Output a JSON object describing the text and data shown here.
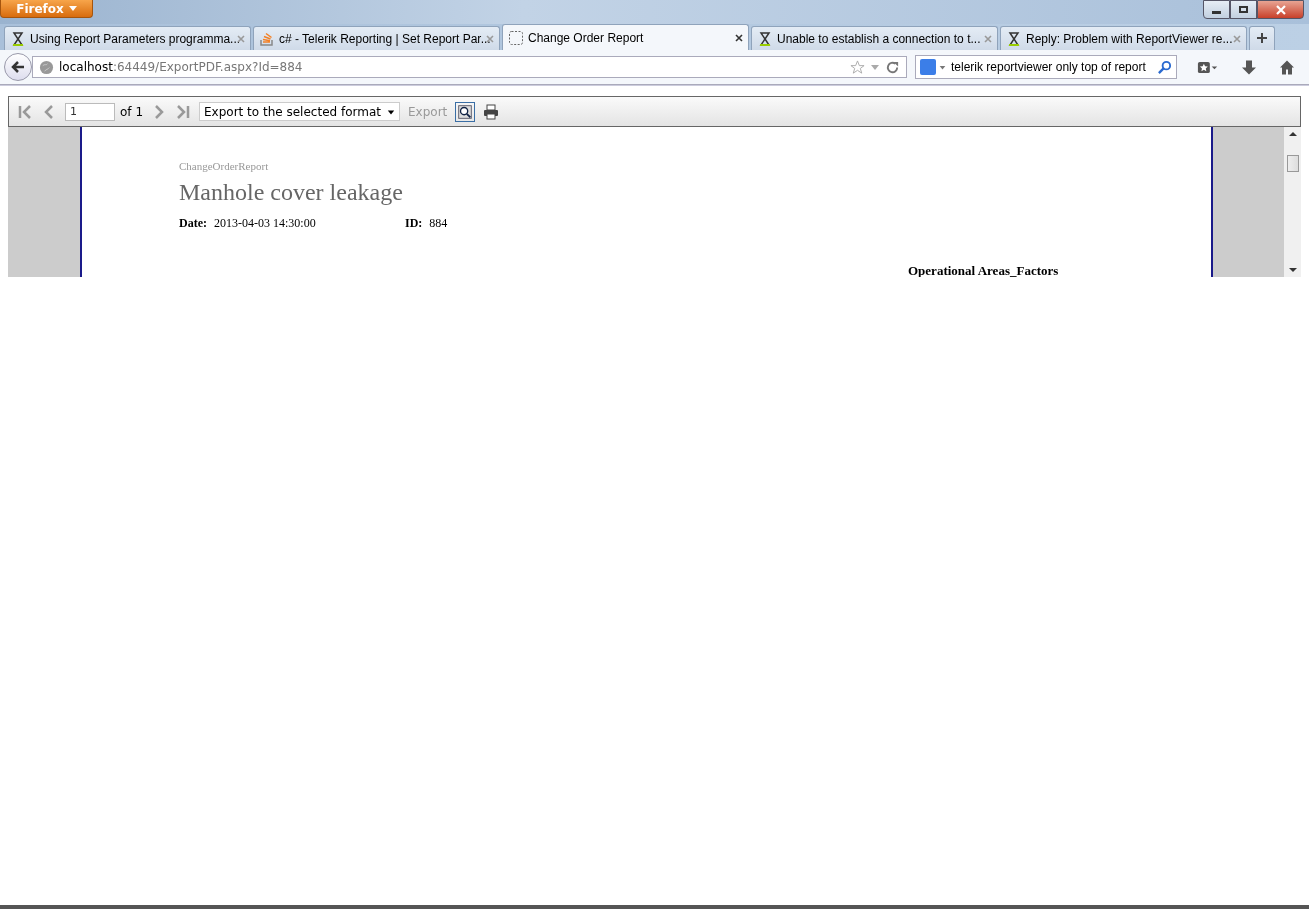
{
  "app_button": "Firefox",
  "tabs": [
    {
      "title": "Using Report Parameters programma...",
      "selected": false,
      "kind": "hourglass"
    },
    {
      "title": "c# - Telerik Reporting | Set Report Par...",
      "selected": false,
      "kind": "stack"
    },
    {
      "title": "Change Order Report",
      "selected": true,
      "kind": "page"
    },
    {
      "title": "Unable to establish a connection to t...",
      "selected": false,
      "kind": "hourglass"
    },
    {
      "title": "Reply: Problem with ReportViewer re...",
      "selected": false,
      "kind": "hourglass"
    }
  ],
  "address": {
    "host": "localhost",
    "rest": ":64449/ExportPDF.aspx?Id=884"
  },
  "search": {
    "value": "telerik reportviewer only top of report"
  },
  "viewer_toolbar": {
    "page": "1",
    "of": "of 1",
    "format": "Export to the selected format",
    "export": "Export"
  },
  "report": {
    "name": "ChangeOrderReport",
    "title": "Manhole cover leakage",
    "date_label": "Date:",
    "date": "2013-04-03 14:30:00",
    "id_label": "ID:",
    "id": "884",
    "section": "Operational Areas_Factors"
  }
}
